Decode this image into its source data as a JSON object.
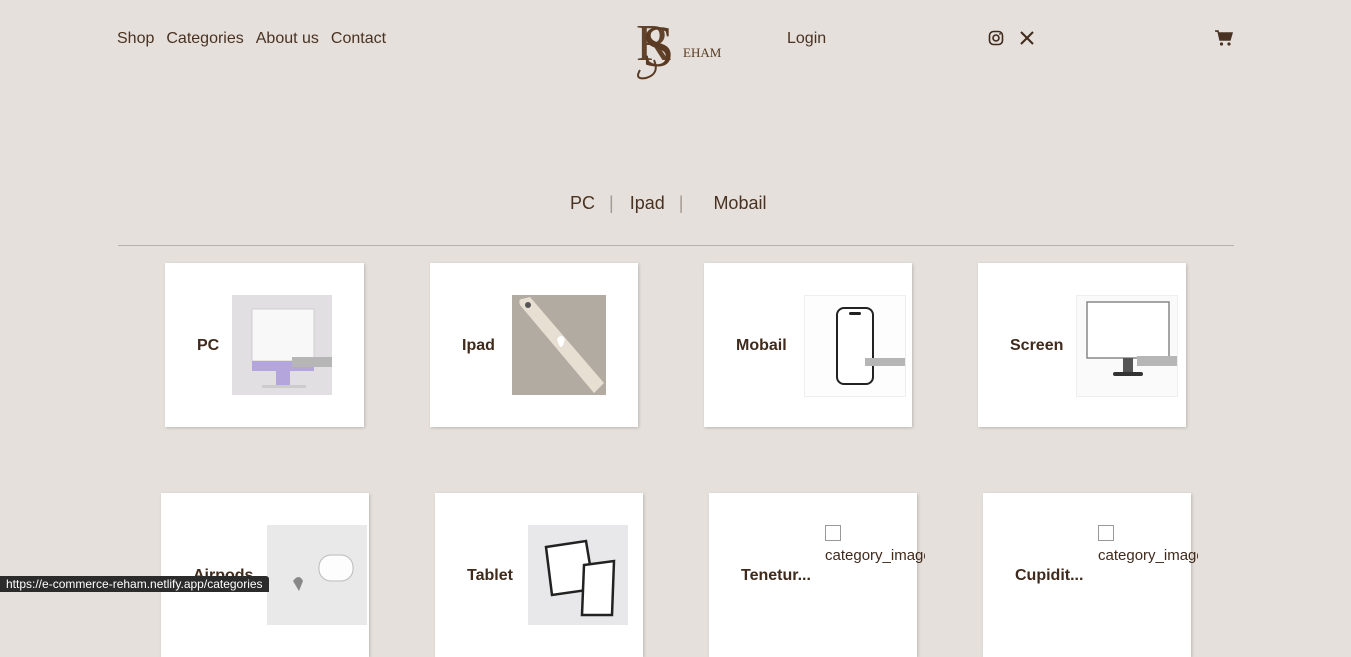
{
  "nav": {
    "links": [
      "Shop",
      "Categories",
      "About us",
      "Contact"
    ],
    "login": "Login",
    "logo_text": "EHAM"
  },
  "filter": {
    "tabs": [
      "PC",
      "Ipad",
      "Mobail"
    ],
    "separator": "|"
  },
  "categories": [
    {
      "name": "PC"
    },
    {
      "name": "Ipad"
    },
    {
      "name": "Mobail"
    },
    {
      "name": "Screen"
    },
    {
      "name": "Airpods"
    },
    {
      "name": "Tablet"
    },
    {
      "name": "Tenetur...",
      "image_alt": "category_image"
    },
    {
      "name": "Cupidit...",
      "image_alt": "category_image"
    }
  ],
  "status_bar": {
    "url": "https://e-commerce-reham.netlify.app/categories"
  },
  "colors": {
    "background": "#e5e0db",
    "brand": "#5a3a22",
    "text": "#4a3222"
  }
}
